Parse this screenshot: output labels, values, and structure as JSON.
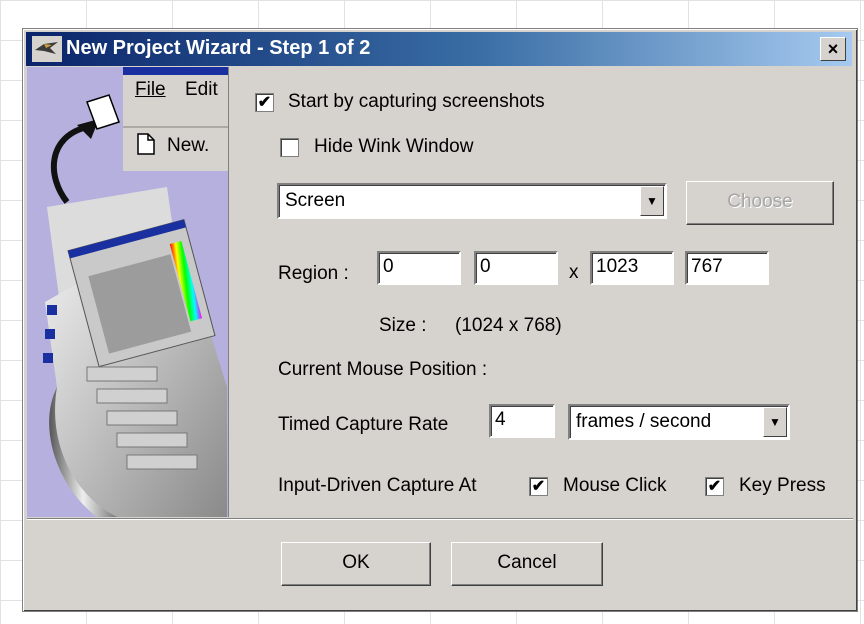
{
  "window": {
    "title": "New Project Wizard - Step 1 of 2",
    "close_glyph": "×"
  },
  "side_image": {
    "menu_file": "File",
    "menu_edit": "Edit",
    "menu_new": "New."
  },
  "capture": {
    "start_by_capturing_label": "Start by capturing screenshots",
    "start_by_capturing_checked": true,
    "hide_wink_label": "Hide Wink Window",
    "hide_wink_checked": false,
    "source_value": "Screen",
    "choose_label": "Choose",
    "region_label": "Region :",
    "region_x": "0",
    "region_y": "0",
    "region_sep": "x",
    "region_w": "1023",
    "region_h": "767",
    "size_label": "Size :",
    "size_value": "(1024 x 768)",
    "mouse_position_label": "Current Mouse Position :",
    "timed_rate_label": "Timed Capture Rate",
    "timed_rate_value": "4",
    "rate_unit_value": "frames / second",
    "input_driven_label": "Input-Driven Capture At",
    "mouse_click_label": "Mouse Click",
    "mouse_click_checked": true,
    "key_press_label": "Key Press",
    "key_press_checked": true
  },
  "footer": {
    "ok_label": "OK",
    "cancel_label": "Cancel"
  },
  "icons": {
    "check": "✔",
    "dropdown": "▼"
  }
}
